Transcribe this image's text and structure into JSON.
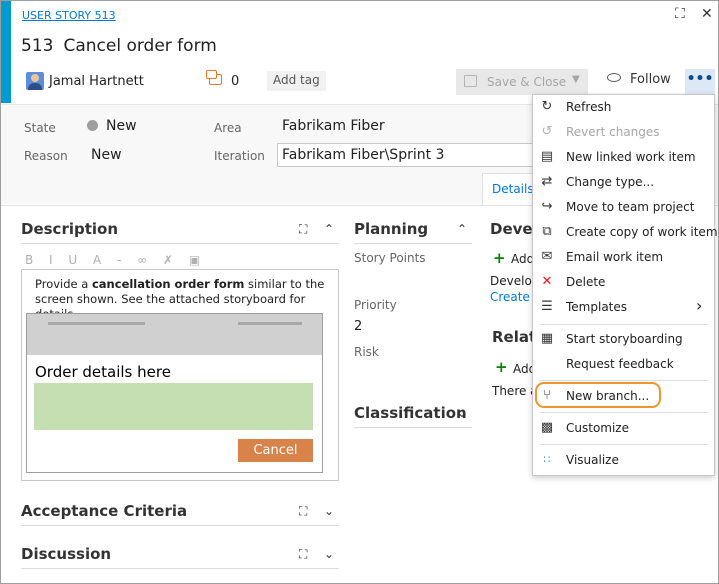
{
  "header": {
    "work_item_type": "USER STORY 513",
    "id": "513",
    "title": "Cancel order form",
    "assigned_to": "Jamal Hartnett",
    "comment_count": "0",
    "add_tag_label": "Add tag",
    "save_close_label": "Save & Close",
    "follow_label": "Follow",
    "more_label": "•••",
    "expand_glyph": "⛶",
    "close_glyph": "✕"
  },
  "fields": {
    "state_label": "State",
    "state_value": "New",
    "reason_label": "Reason",
    "reason_value": "New",
    "area_label": "Area",
    "area_value": "Fabrikam Fiber",
    "iteration_label": "Iteration",
    "iteration_value": "Fabrikam Fiber\\Sprint 3"
  },
  "tabs": {
    "details_label": "Details"
  },
  "description": {
    "title": "Description",
    "toolbar_glyphs": "B I U A ‐ ∞ ✗ ▣",
    "text_pre": "Provide a ",
    "text_bold": "cancellation order form",
    "text_post": " similar to the screen shown. See the attached storyboard for details.",
    "storyboard_title": "Order details here",
    "storyboard_cancel": "Cancel"
  },
  "sections": {
    "acceptance_title": "Acceptance Criteria",
    "discussion_title": "Discussion",
    "planning_title": "Planning",
    "classification_title": "Classification",
    "development_title": "Develo",
    "related_title": "Relate"
  },
  "planning": {
    "story_points_label": "Story Points",
    "priority_label": "Priority",
    "priority_value": "2",
    "risk_label": "Risk"
  },
  "development": {
    "add_label": "Add",
    "develop_text": "Develop",
    "create_link": "Create a"
  },
  "related": {
    "add_label": "Add",
    "there_text": "There a"
  },
  "menu": {
    "items": [
      {
        "label": "Refresh",
        "icon": "refresh-icon",
        "glyph": "↻"
      },
      {
        "label": "Revert changes",
        "icon": "revert-icon",
        "glyph": "↺"
      },
      {
        "label": "New linked work item",
        "icon": "new-linked-icon",
        "glyph": "▤"
      },
      {
        "label": "Change type...",
        "icon": "change-type-icon",
        "glyph": "⇄"
      },
      {
        "label": "Move to team project",
        "icon": "move-icon",
        "glyph": "↪"
      },
      {
        "label": "Create copy of work item...",
        "icon": "copy-icon",
        "glyph": "⧉"
      },
      {
        "label": "Email work item",
        "icon": "email-icon",
        "glyph": "✉"
      },
      {
        "label": "Delete",
        "icon": "delete-icon",
        "glyph": "✕"
      },
      {
        "label": "Templates",
        "icon": "templates-icon",
        "glyph": "☰"
      },
      {
        "label": "Start storyboarding",
        "icon": "storyboard-icon",
        "glyph": "▦"
      },
      {
        "label": "Request feedback",
        "icon": "",
        "glyph": ""
      },
      {
        "label": "New branch...",
        "icon": "branch-icon",
        "glyph": "⑂"
      },
      {
        "label": "Customize",
        "icon": "customize-icon",
        "glyph": "▩"
      },
      {
        "label": "Visualize",
        "icon": "visualize-icon",
        "glyph": "∷"
      }
    ],
    "templates_arrow": "›"
  },
  "colors": {
    "accent_bar": "#009ccc",
    "link": "#0078d4",
    "delete_red": "#e81123",
    "highlight_orange": "#f0962a"
  }
}
